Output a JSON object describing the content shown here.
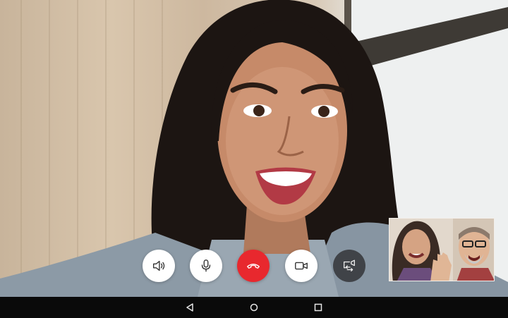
{
  "call": {
    "remote_video": "video-feed",
    "self_preview": "video-feed"
  },
  "controls": {
    "speaker": {
      "icon": "speaker-icon"
    },
    "mic": {
      "icon": "microphone-icon"
    },
    "end_call": {
      "icon": "phone-hangup-icon",
      "color": "#e8282e"
    },
    "video": {
      "icon": "video-camera-icon"
    },
    "switch_camera": {
      "icon": "switch-camera-icon"
    }
  },
  "nav_bar": {
    "back": {
      "icon": "back-triangle-icon"
    },
    "home": {
      "icon": "home-circle-icon"
    },
    "recent": {
      "icon": "recent-apps-square-icon"
    }
  }
}
